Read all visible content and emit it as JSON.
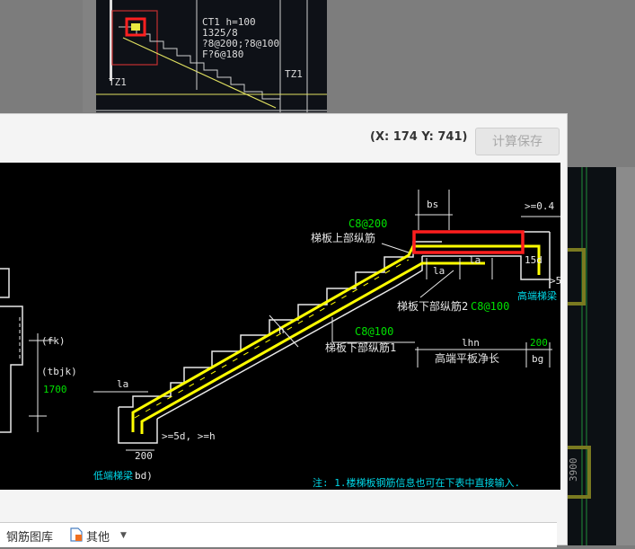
{
  "thumbnail": {
    "labels": [
      "CT1 h=100",
      "1325/8",
      "?8@200;?8@100",
      "F?6@180",
      "TZ1",
      "TZ1"
    ]
  },
  "dialog": {
    "coords": "(X: 174 Y: 741)",
    "calc_save_label": "计算保存"
  },
  "drawing": {
    "bs": "bs",
    "min_dim": ">=0.4",
    "top_rebar_spec": "C8@200",
    "top_rebar_label": "梯板上部纵筋",
    "la_1": "la",
    "la_2": "la",
    "d15": "15d",
    "d5": ">5",
    "high_beam": "高端梯梁",
    "bottom_rebar2_label": "梯板下部纵筋2",
    "bottom_rebar2_spec": "C8@100",
    "bottom_rebar1_spec": "C8@100",
    "bottom_rebar1_label": "梯板下部纵筋1",
    "h": "h",
    "lhn": "lhn",
    "dim_200": "200",
    "flat_len_label": "高端平板净长",
    "bg": "bg",
    "fk": "(fk)",
    "tbjk": "(tbjk)",
    "val_1700": "1700",
    "la_3": "la",
    "d5h": ">=5d, >=h",
    "low_200": "200",
    "low_beam": "低端梯梁",
    "bd": "bd)",
    "note": "注: 1.楼梯板钢筋信息也可在下表中直接输入.",
    "side_num": "3900"
  },
  "toolbar": {
    "rebar_library": "钢筋图库",
    "other": "其他"
  },
  "colors": {
    "rebar": "#ffff00",
    "green_spec": "#00e000",
    "cyan_label": "#00d8e8",
    "highlight": "#ff1e1e",
    "outline": "#e8e8e8"
  }
}
